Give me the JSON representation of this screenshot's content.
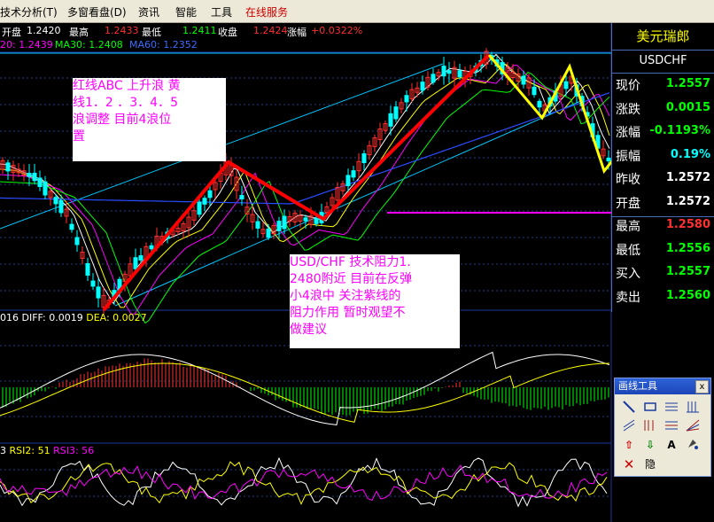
{
  "menu": {
    "items": [
      "技术分析(T)",
      "多窗看盘(D)",
      "资讯",
      "智能",
      "工具",
      "在线服务"
    ]
  },
  "info": {
    "open_label": "开盘",
    "open": "1.2420",
    "high_label": "最高",
    "high": "1.2433",
    "low_label": "最低",
    "low": "1.2411",
    "close_label": "收盘",
    "close": "1.2424",
    "change_label": "涨幅",
    "change": "+0.0322%"
  },
  "ma": {
    "ma20": "20: 1.2439",
    "ma30": "MA30: 1.2408",
    "ma60": "MA60: 1.2352"
  },
  "macd": {
    "label": "016",
    "diff": "DIFF: 0.0019",
    "dea": "DEA: 0.0027"
  },
  "rsi": {
    "rsi1": "3",
    "rsi2": "RSI2: 51",
    "rsi3": "RSI3: 56"
  },
  "quote": {
    "name": "美元瑞郎",
    "code": "USDCHF",
    "rows": [
      {
        "label": "现价",
        "value": "1.2557",
        "color": "#00ff00"
      },
      {
        "label": "涨跌",
        "value": "0.0015",
        "color": "#00ff00"
      },
      {
        "label": "涨幅",
        "value": "-0.1193%",
        "color": "#00ff00"
      },
      {
        "label": "振幅",
        "value": "0.19%",
        "color": "#00ffff"
      },
      {
        "label": "昨收",
        "value": "1.2572",
        "color": "#ffffff"
      },
      {
        "label": "开盘",
        "value": "1.2572",
        "color": "#ffffff"
      },
      {
        "label": "最高",
        "value": "1.2580",
        "color": "#ff3030"
      },
      {
        "label": "最低",
        "value": "1.2556",
        "color": "#00ff00"
      },
      {
        "label": "买入",
        "value": "1.2557",
        "color": "#00ff00"
      },
      {
        "label": "卖出",
        "value": "1.2560",
        "color": "#00ff00"
      }
    ]
  },
  "notes": {
    "wave": "红线ABC 上升浪 黄\n线1．2 ．3．4．5\n浪调整 目前4浪位\n置",
    "resistance": "USD/CHF 技术阻力1.\n2480附近 目前在反弹\n小4浪中 关注紫线的\n阻力作用 暂时观望不\n做建议"
  },
  "toolbox": {
    "title": "画线工具",
    "close": "x",
    "hide_label": "隐"
  },
  "colors": {
    "up": "#ff3030",
    "down": "#00ffff",
    "ma5": "#ffffff",
    "ma10": "#ffff00",
    "ma20": "#ff00ff",
    "ma30": "#00ff00",
    "ma60": "#2a4cff",
    "wave_red": "#ff0000",
    "wave_yellow": "#ffff00",
    "resistance": "#ff00ff"
  }
}
